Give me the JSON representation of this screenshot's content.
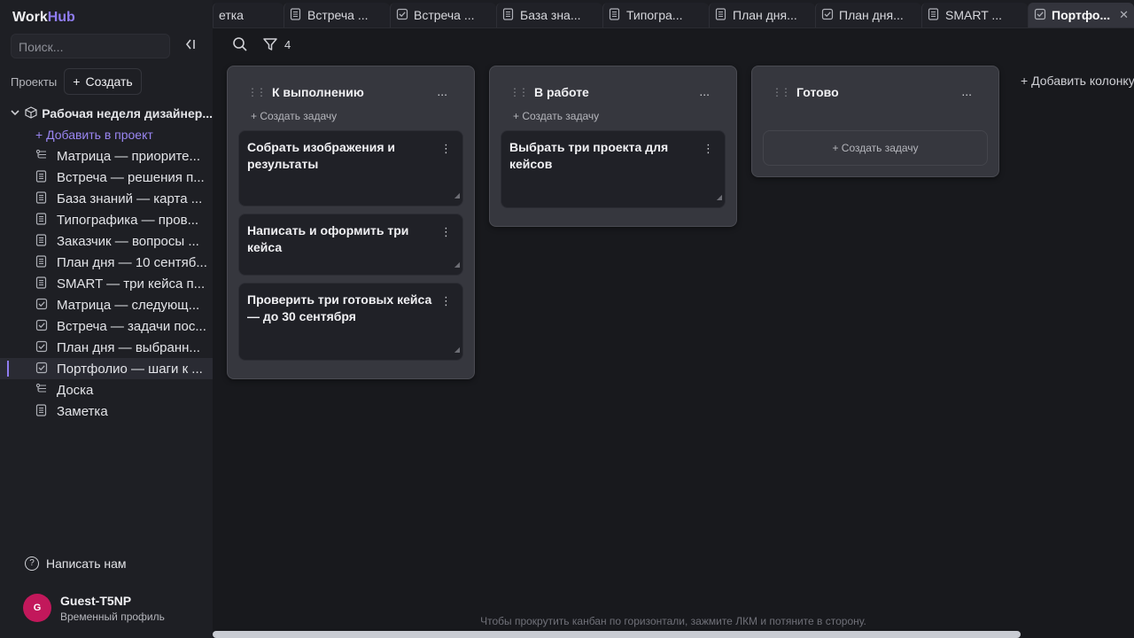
{
  "app": {
    "brand_work": "Work",
    "brand_hub": "Hub"
  },
  "sidebar": {
    "search_placeholder": "Поиск...",
    "projects_label": "Проекты",
    "create_label": "Создать",
    "project": {
      "name": "Рабочая неделя дизайнер..."
    },
    "add_to_project": "+ Добавить в проект",
    "items": [
      {
        "icon": "board-icon",
        "label": "Матрица — приорите..."
      },
      {
        "icon": "note-icon",
        "label": "Встреча — решения п..."
      },
      {
        "icon": "note-icon",
        "label": "База знаний — карта ..."
      },
      {
        "icon": "note-icon",
        "label": "Типографика — пров..."
      },
      {
        "icon": "note-icon",
        "label": "Заказчик — вопросы ..."
      },
      {
        "icon": "note-icon",
        "label": "План дня — 10 сентяб..."
      },
      {
        "icon": "note-icon",
        "label": "SMART — три кейса п..."
      },
      {
        "icon": "task-icon",
        "label": "Матрица — следующ..."
      },
      {
        "icon": "task-icon",
        "label": "Встреча — задачи пос..."
      },
      {
        "icon": "task-icon",
        "label": "План дня — выбранн..."
      },
      {
        "icon": "task-icon",
        "label": "Портфолио — шаги к ..."
      },
      {
        "icon": "board-icon",
        "label": "Доска"
      },
      {
        "icon": "note-icon",
        "label": "Заметка"
      }
    ],
    "active_index": 10,
    "help_label": "Написать нам",
    "user": {
      "initial": "G",
      "name": "Guest-T5NP",
      "subtitle": "Временный профиль"
    }
  },
  "tabs": [
    {
      "icon": "",
      "label": "етка"
    },
    {
      "icon": "note-icon",
      "label": "Встреча ..."
    },
    {
      "icon": "task-icon",
      "label": "Встреча ..."
    },
    {
      "icon": "note-icon",
      "label": "База зна..."
    },
    {
      "icon": "note-icon",
      "label": "Типогра..."
    },
    {
      "icon": "note-icon",
      "label": "План дня..."
    },
    {
      "icon": "task-icon",
      "label": "План дня..."
    },
    {
      "icon": "note-icon",
      "label": "SMART ..."
    },
    {
      "icon": "task-icon",
      "label": "Портфо...",
      "active": true
    }
  ],
  "toolbar": {
    "filter_count": "4"
  },
  "kanban": {
    "add_task_label": "+ Создать задачу",
    "columns": [
      {
        "title": "К выполнению",
        "cards": [
          "Собрать изображения и результаты",
          "Написать и оформить три кейса",
          "Проверить три готовых кейса — до 30 сентября"
        ]
      },
      {
        "title": "В работе",
        "cards": [
          "Выбрать три проекта для кейсов"
        ]
      },
      {
        "title": "Готово",
        "cards": []
      }
    ],
    "add_column_label": "+ Добавить колонку",
    "hint": "Чтобы прокрутить канбан по горизонтали, зажмите ЛКМ и потяните в сторону."
  },
  "colors": {
    "accent": "#8f7cf0",
    "avatar": "#c2185b"
  }
}
